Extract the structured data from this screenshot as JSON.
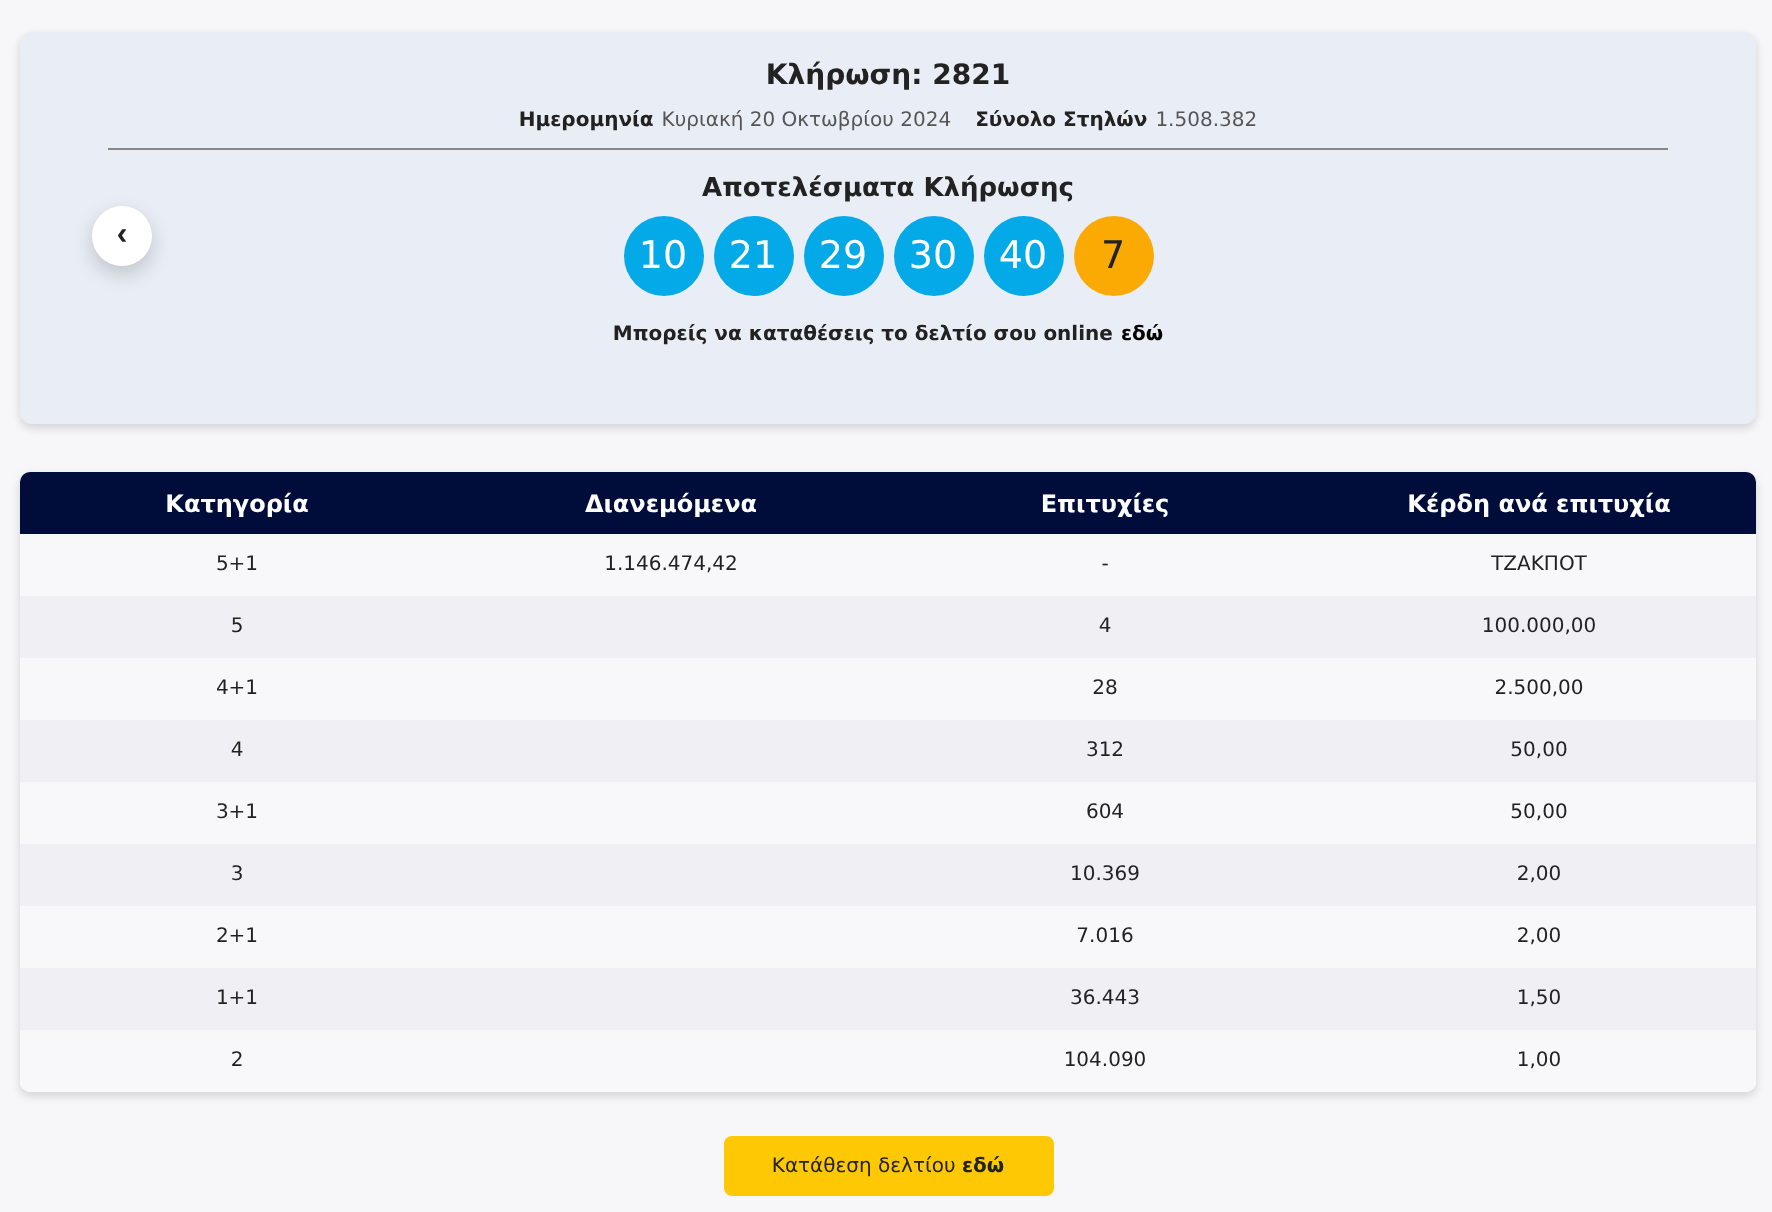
{
  "draw": {
    "title": "Κλήρωση: 2821",
    "date_label": "Ημερομηνία",
    "date": "Κυριακή 20 Οκτωβρίου 2024",
    "total_label": "Σύνολο Στηλών",
    "total": "1.508.382",
    "prev_button": "‹",
    "results_title": "Αποτελέσματα Κλήρωσης",
    "balls": [
      {
        "number": "10",
        "kind": "main"
      },
      {
        "number": "21",
        "kind": "main"
      },
      {
        "number": "29",
        "kind": "main"
      },
      {
        "number": "30",
        "kind": "main"
      },
      {
        "number": "40",
        "kind": "main"
      },
      {
        "number": "7",
        "kind": "bonus"
      }
    ],
    "online_note": "Μπορείς να καταθέσεις το δελτίο σου online",
    "online_link": "εδώ"
  },
  "table": {
    "columns": [
      "Κατηγορία",
      "Διανεμόμενα",
      "Επιτυχίες",
      "Κέρδη ανά επιτυχία"
    ],
    "rows": [
      [
        "5+1",
        "1.146.474,42",
        "-",
        "ΤΖΑΚΠΟΤ"
      ],
      [
        "5",
        "",
        "4",
        "100.000,00"
      ],
      [
        "4+1",
        "",
        "28",
        "2.500,00"
      ],
      [
        "4",
        "",
        "312",
        "50,00"
      ],
      [
        "3+1",
        "",
        "604",
        "50,00"
      ],
      [
        "3",
        "",
        "10.369",
        "2,00"
      ],
      [
        "2+1",
        "",
        "7.016",
        "2,00"
      ],
      [
        "1+1",
        "",
        "36.443",
        "1,50"
      ],
      [
        "2",
        "",
        "104.090",
        "1,00"
      ]
    ]
  },
  "submit_button": "Κατάθεση δελτίου **εδώ**"
}
